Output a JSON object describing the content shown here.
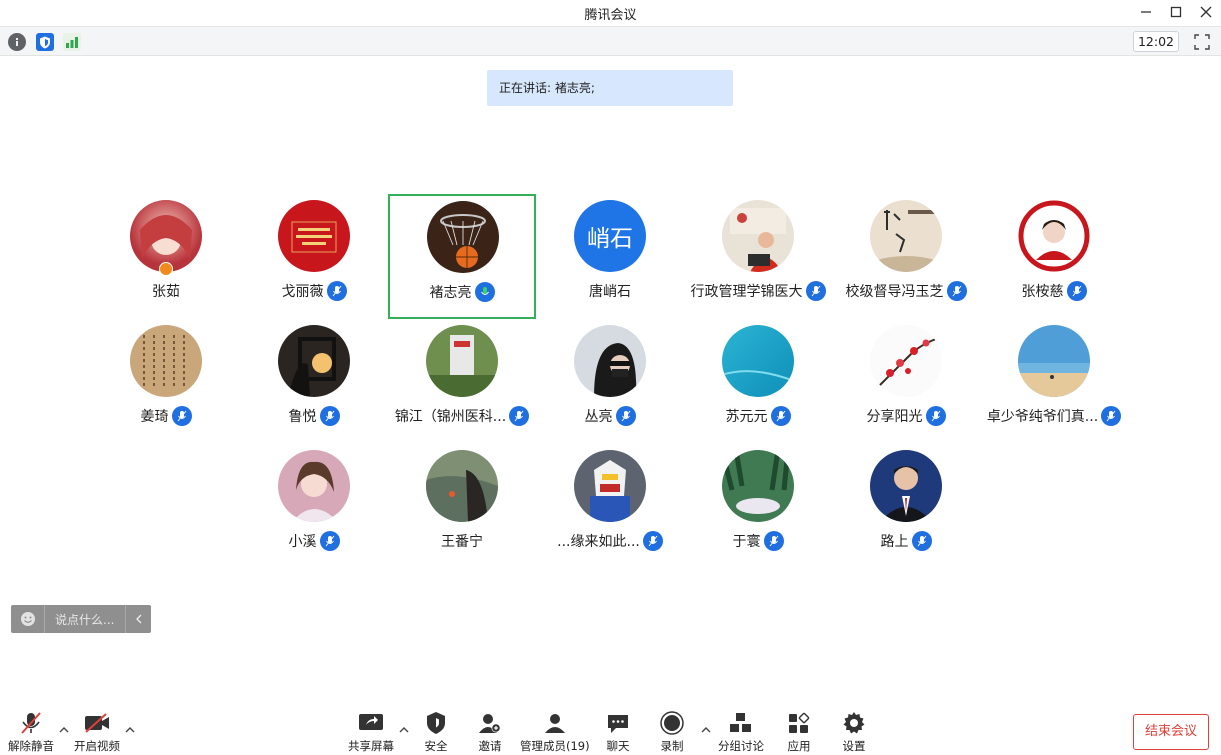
{
  "window": {
    "title": "腾讯会议"
  },
  "topbar": {
    "time": "12:02"
  },
  "banner": {
    "label": "正在讲话:",
    "speaker": "褚志亮;"
  },
  "participants": [
    {
      "name": "张茹",
      "mic": "none",
      "host": true
    },
    {
      "name": "戈丽薇",
      "mic": "muted"
    },
    {
      "name": "褚志亮",
      "mic": "speaking"
    },
    {
      "name": "唐峭石",
      "mic": "none",
      "avatar_text": "峭石"
    },
    {
      "name": "行政管理学锦医大",
      "mic": "muted"
    },
    {
      "name": "校级督导冯玉芝",
      "mic": "muted"
    },
    {
      "name": "张桉慈",
      "mic": "muted"
    },
    {
      "name": "姜琦",
      "mic": "muted"
    },
    {
      "name": "鲁悦",
      "mic": "muted"
    },
    {
      "name": "锦江（锦州医科...",
      "mic": "muted"
    },
    {
      "name": "丛亮",
      "mic": "muted"
    },
    {
      "name": "苏元元",
      "mic": "muted"
    },
    {
      "name": "分享阳光",
      "mic": "muted"
    },
    {
      "name": "卓少爷纯爷们真...",
      "mic": "muted"
    },
    {
      "name": "小溪",
      "mic": "muted"
    },
    {
      "name": "王番宁",
      "mic": "none"
    },
    {
      "name": "...缘来如此...",
      "mic": "muted"
    },
    {
      "name": "于寰",
      "mic": "muted"
    },
    {
      "name": "路上",
      "mic": "muted"
    }
  ],
  "chat": {
    "placeholder": "说点什么..."
  },
  "bottombar": {
    "unmute": "解除静音",
    "video": "开启视频",
    "share": "共享屏幕",
    "security": "安全",
    "invite": "邀请",
    "members": "管理成员(19)",
    "chat": "聊天",
    "record": "录制",
    "breakout": "分组讨论",
    "apps": "应用",
    "settings": "设置",
    "end": "结束会议"
  },
  "colors": {
    "accent": "#1f6fe0",
    "speaking_border": "#34b05b",
    "end": "#e0403a",
    "banner": "#d7e7fd"
  }
}
